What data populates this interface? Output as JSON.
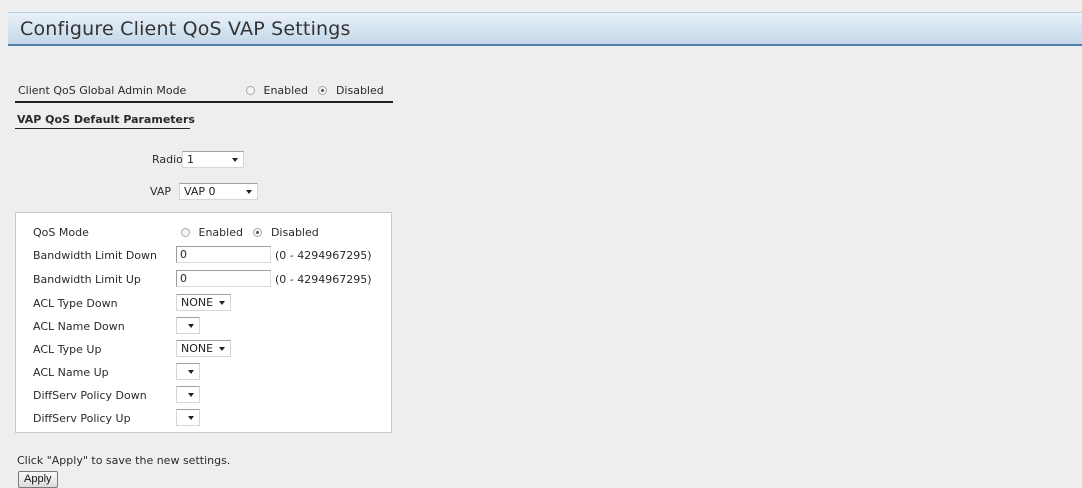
{
  "page": {
    "title": "Configure Client QoS VAP Settings"
  },
  "global": {
    "label": "Client QoS Global Admin Mode",
    "enabled_label": "Enabled",
    "disabled_label": "Disabled",
    "selected": "Disabled"
  },
  "section": {
    "title": "VAP QoS Default Parameters"
  },
  "radio_select": {
    "label": "Radio",
    "value": "1"
  },
  "vap_select": {
    "label": "VAP",
    "value": "VAP 0"
  },
  "params": {
    "qos_mode": {
      "label": "QoS Mode",
      "enabled_label": "Enabled",
      "disabled_label": "Disabled",
      "selected": "Disabled"
    },
    "bw_down": {
      "label": "Bandwidth Limit Down",
      "value": "0",
      "range": "(0 - 4294967295)"
    },
    "bw_up": {
      "label": "Bandwidth Limit Up",
      "value": "0",
      "range": "(0 - 4294967295)"
    },
    "acl_type_down": {
      "label": "ACL Type Down",
      "value": "NONE"
    },
    "acl_name_down": {
      "label": "ACL Name Down",
      "value": ""
    },
    "acl_type_up": {
      "label": "ACL Type Up",
      "value": "NONE"
    },
    "acl_name_up": {
      "label": "ACL Name Up",
      "value": ""
    },
    "diffserv_down": {
      "label": "DiffServ Policy Down",
      "value": ""
    },
    "diffserv_up": {
      "label": "DiffServ Policy Up",
      "value": ""
    }
  },
  "footer": {
    "note": "Click \"Apply\" to save the new settings.",
    "apply_label": "Apply"
  }
}
